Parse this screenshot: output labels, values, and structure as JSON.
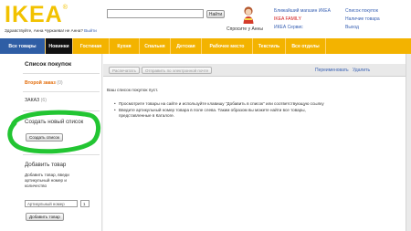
{
  "header": {
    "logo": "IKEA",
    "logo_reg": "®",
    "welcome_text": "Здравствуйте, Анна Чуркаева! не Анна?",
    "logout": "Выйти",
    "search_value": "",
    "search_button": "Найти",
    "ask_label": "Спросите у Анны",
    "links_mid": [
      "Ближайший магазин ИКЕА",
      "IKEA FAMILY",
      "ИКЕА Сервис"
    ],
    "links_right": [
      "Список покупок",
      "Наличие товара",
      "Выход"
    ]
  },
  "nav": {
    "items": [
      {
        "label": "Все товары"
      },
      {
        "label": "Новинки"
      },
      {
        "label": "Гостиная"
      },
      {
        "label": "Кухня"
      },
      {
        "label": "Спальня"
      },
      {
        "label": "Детская"
      },
      {
        "label": "Рабочее место"
      },
      {
        "label": "Текстиль"
      },
      {
        "label": "Все отделы"
      }
    ]
  },
  "sidebar": {
    "title": "Список покупок",
    "lists": [
      {
        "name": "Второй заказ",
        "count": "(0)"
      },
      {
        "name": "ЗАКАЗ",
        "count": "(6)"
      }
    ],
    "create_title": "Создать новый список",
    "create_button": "Создать список",
    "add_title": "Добавить товар",
    "add_desc": "Добавить товар, введи артикульный номер и количество",
    "article_placeholder": "Артикульный номер",
    "qty_value": "1",
    "add_button": "Добавить товар"
  },
  "main": {
    "print_button": "Распечатать",
    "email_button": "Отправить по электронной почте",
    "rename_link": "Переименовать",
    "delete_link": "Удалить",
    "empty_message": "Ваш список покупок пуст.",
    "tips": [
      "Просмотрите товары на сайте и используйте клавишу \"Добавить в список\" или соответствующую ссылку",
      "Введите артикульный номер товара в поле слева. Таким образом вы можете найти все товары, представленные в Каталоге."
    ]
  },
  "colors": {
    "brand_yellow": "#f3b300",
    "nav_blue": "#2f5ea5",
    "link_blue": "#3a62b4",
    "active_orange": "#e36c09",
    "ring_green": "#22c532"
  }
}
